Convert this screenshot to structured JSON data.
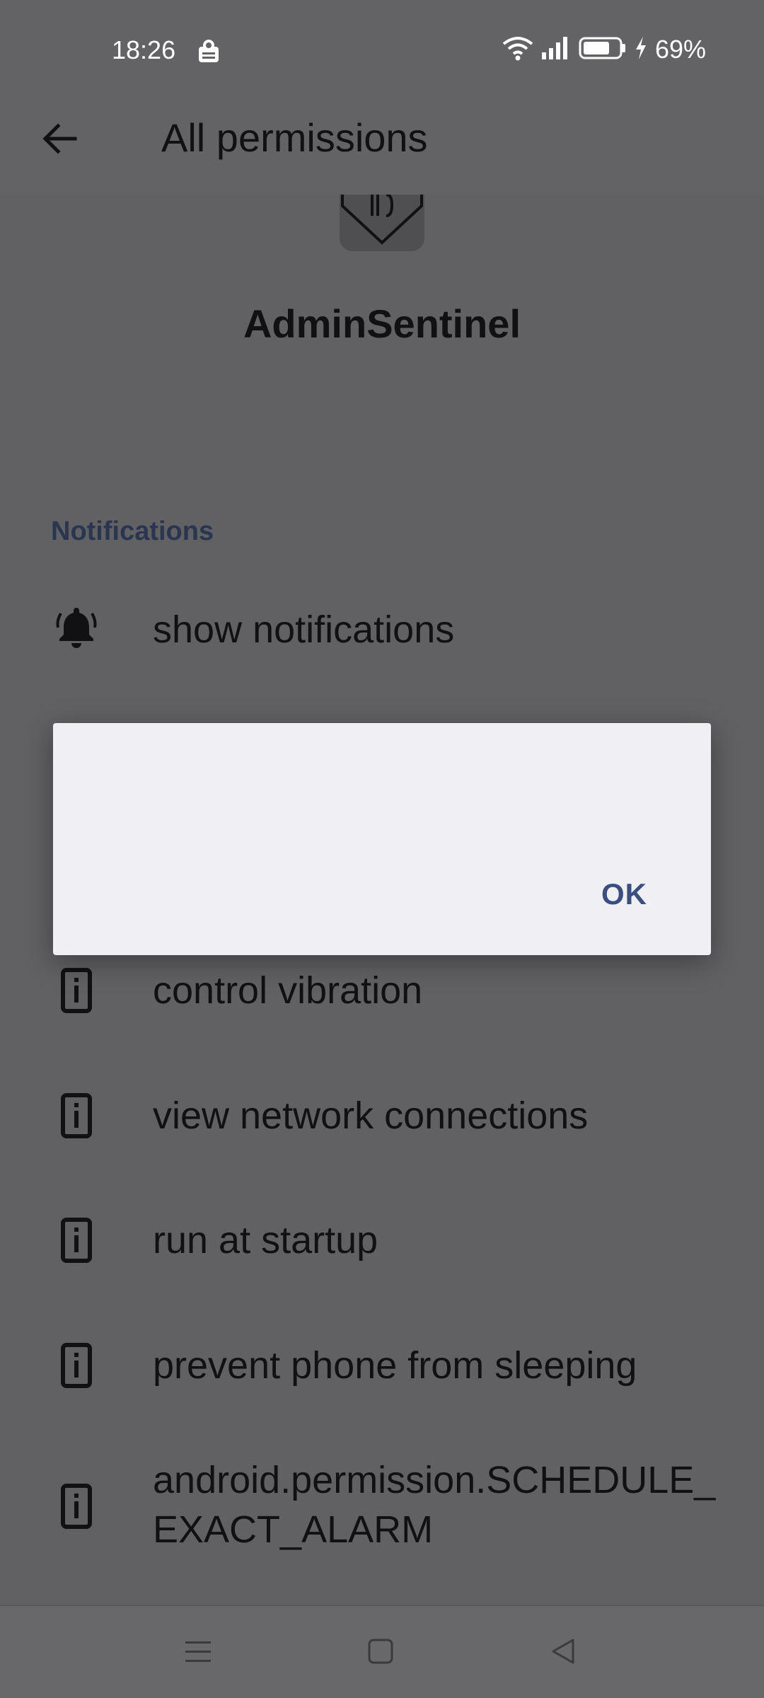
{
  "status_bar": {
    "time": "18:26",
    "battery_percent": "69%",
    "icons": [
      "notification-app-icon",
      "wifi-icon",
      "signal-icon",
      "battery-icon",
      "charging-icon"
    ]
  },
  "app_bar": {
    "back_icon": "back-arrow-icon",
    "title": "All permissions"
  },
  "app_header": {
    "app_name": "AdminSentinel",
    "icon": "app-logo-icon"
  },
  "sections": [
    {
      "header": "Notifications",
      "items": [
        {
          "label": "show notifications",
          "icon": "bell-icon"
        }
      ]
    },
    {
      "header": "",
      "items": [
        {
          "label": "control vibration",
          "icon": "info-icon"
        },
        {
          "label": "view network connections",
          "icon": "info-icon"
        },
        {
          "label": "run at startup",
          "icon": "info-icon"
        },
        {
          "label": "prevent phone from sleeping",
          "icon": "info-icon"
        },
        {
          "label": "android.permission.SCHEDULE_EXACT_ALARM",
          "icon": "info-icon"
        }
      ]
    }
  ],
  "dialog": {
    "ok_label": "OK"
  },
  "nav_bar": {
    "icons": [
      "menu-icon",
      "home-icon",
      "back-triangle-icon"
    ]
  },
  "colors": {
    "background_dimmed": "#626266",
    "dialog_bg": "#efeff4",
    "accent": "#3b4f7e",
    "section_header": "#2a3550"
  }
}
